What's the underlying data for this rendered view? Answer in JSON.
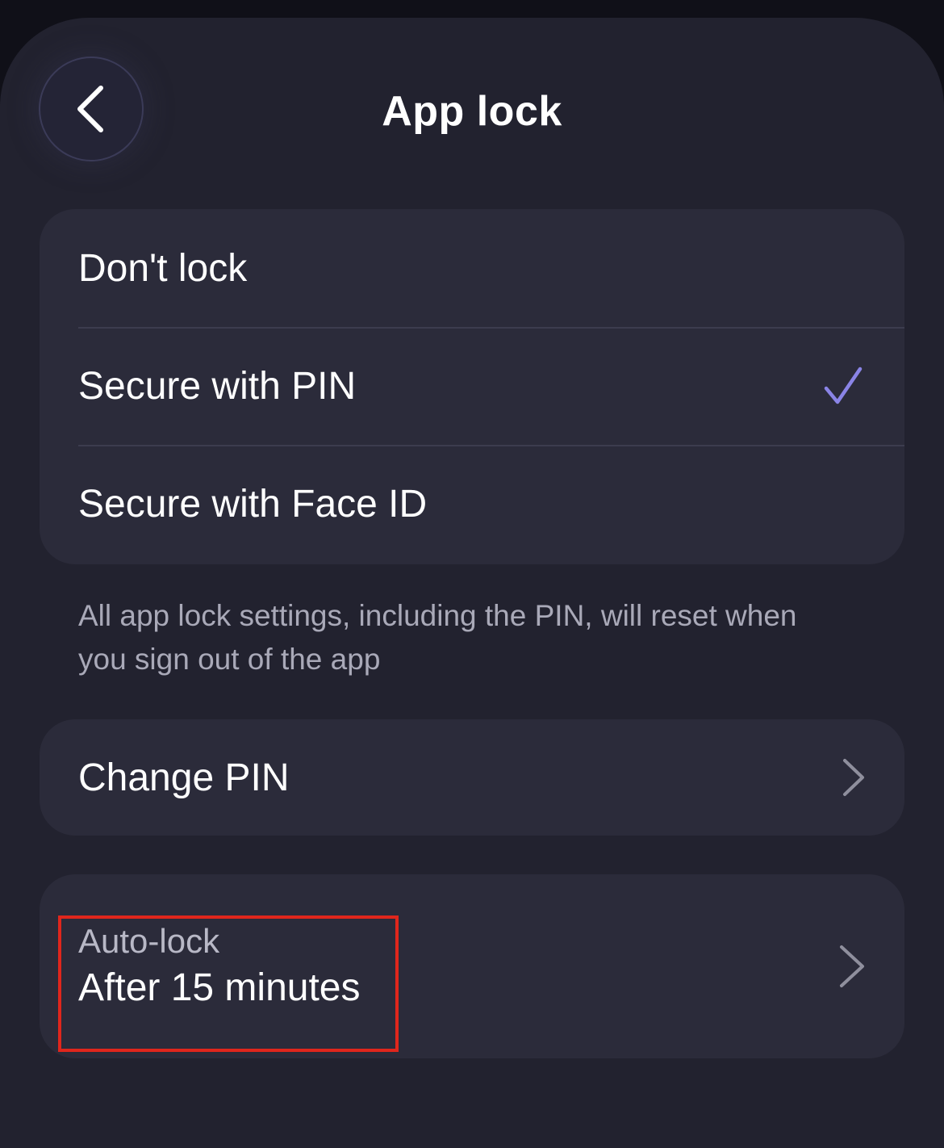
{
  "header": {
    "title": "App lock",
    "back_icon": "chevron-left-icon"
  },
  "lock_options": {
    "items": [
      {
        "label": "Don't lock",
        "selected": false
      },
      {
        "label": "Secure with PIN",
        "selected": true
      },
      {
        "label": "Secure with Face ID",
        "selected": false
      }
    ],
    "check_icon": "checkmark-icon"
  },
  "footnote": "All app lock settings, including the PIN, will reset when you sign out of the app",
  "change_pin": {
    "label": "Change PIN",
    "icon": "chevron-right-icon"
  },
  "auto_lock": {
    "label": "Auto-lock",
    "value": "After 15 minutes",
    "icon": "chevron-right-icon"
  },
  "colors": {
    "background": "#22222f",
    "card": "#2b2b3a",
    "accent": "#8a84e6",
    "highlight": "#e0261c"
  }
}
